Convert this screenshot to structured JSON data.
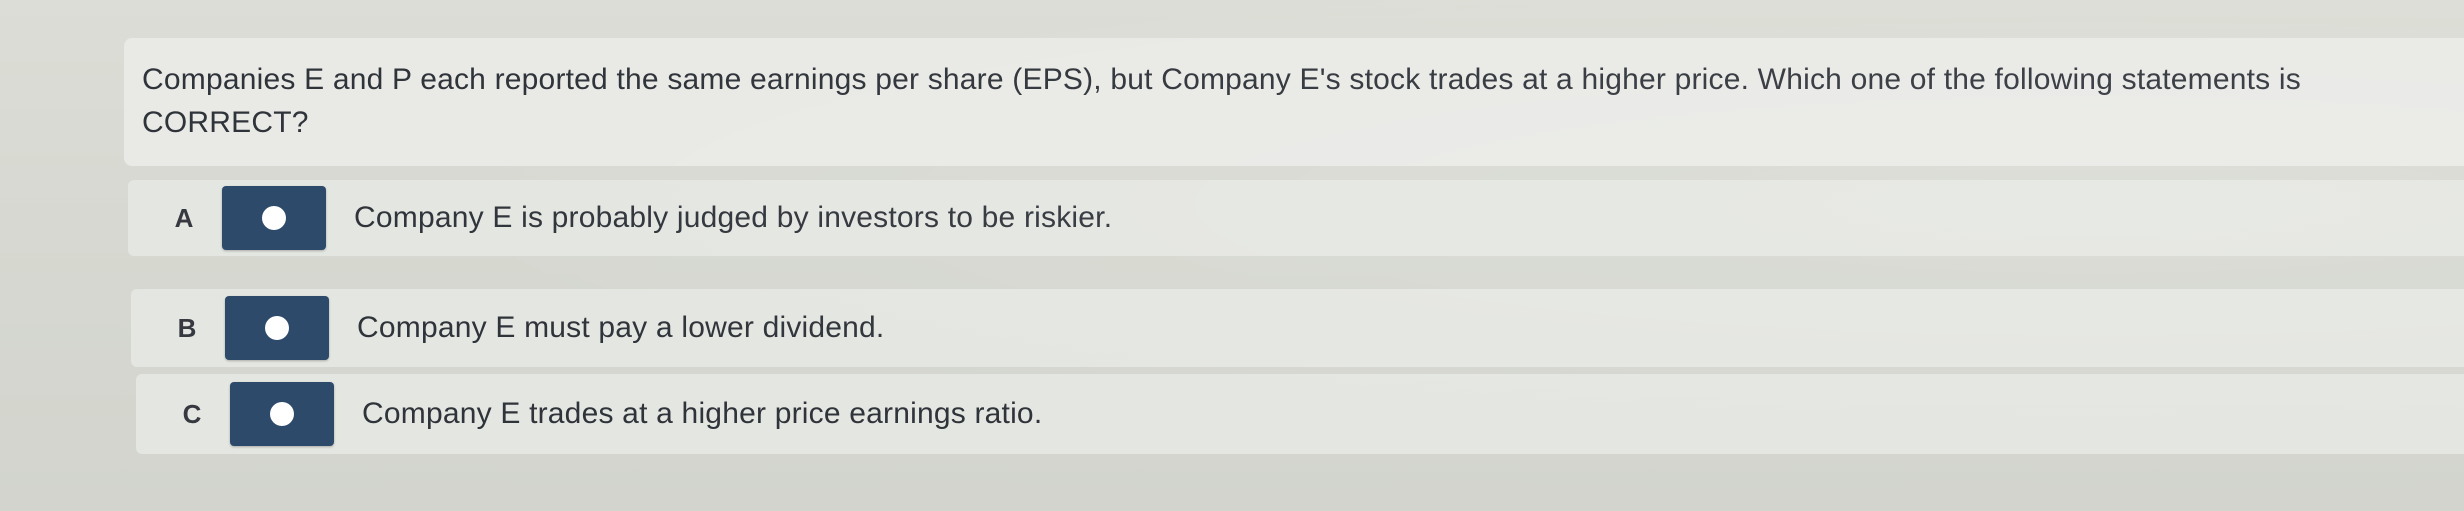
{
  "question": {
    "text": "Companies E and P each reported the same earnings per share (EPS), but Company E's stock trades at a higher price. Which one of the following statements is CORRECT?"
  },
  "options": [
    {
      "letter": "A",
      "text": "Company E is probably judged by investors to be riskier."
    },
    {
      "letter": "B",
      "text": "Company E must pay a lower dividend."
    },
    {
      "letter": "C",
      "text": "Company E trades at a higher price earnings ratio."
    }
  ],
  "colors": {
    "radio_box": "#2d4a6b",
    "radio_dot": "#ffffff"
  }
}
